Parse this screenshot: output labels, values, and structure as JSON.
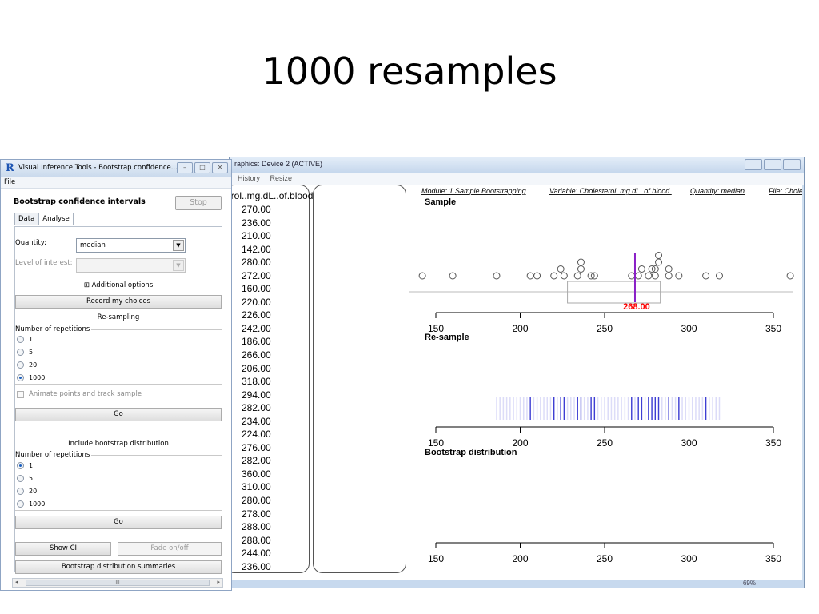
{
  "slide": {
    "title": "1000 resamples"
  },
  "graphics_window": {
    "title": "raphics: Device 2 (ACTIVE)",
    "menu": [
      "History",
      "Resize"
    ],
    "status": "69%",
    "data_column": {
      "header": "erol..mg.dL..of.blood.",
      "values": [
        "270.00",
        "236.00",
        "210.00",
        "142.00",
        "280.00",
        "272.00",
        "160.00",
        "220.00",
        "226.00",
        "242.00",
        "186.00",
        "266.00",
        "206.00",
        "318.00",
        "294.00",
        "282.00",
        "234.00",
        "224.00",
        "276.00",
        "282.00",
        "360.00",
        "310.00",
        "280.00",
        "278.00",
        "288.00",
        "288.00",
        "244.00",
        "236.00"
      ]
    },
    "plot": {
      "header": {
        "module": "Module: 1 Sample Bootstrapping",
        "variable": "Variable: Cholesterol..mg.dL..of.blood.",
        "quantity": "Quantity: median",
        "file": "File: Chole"
      },
      "panels": {
        "sample": "Sample",
        "resample": "Re-sample",
        "bootstrap": "Bootstrap distribution"
      },
      "median_label": "268.00",
      "median_value": 268,
      "axis_ticks": [
        "150",
        "200",
        "250",
        "300",
        "350"
      ],
      "colors": {
        "median_line": "#8a1fc7",
        "median_text": "#ff0000",
        "resample_lines": "#2222cc"
      }
    }
  },
  "chart_data": {
    "type": "scatter",
    "title": "Sample",
    "xlim": [
      150,
      350
    ],
    "sample_points": [
      142,
      160,
      186,
      206,
      210,
      220,
      224,
      226,
      234,
      236,
      236,
      242,
      244,
      266,
      270,
      272,
      276,
      278,
      280,
      280,
      282,
      282,
      288,
      288,
      294,
      310,
      318,
      360
    ],
    "boxplot": {
      "q1": 228,
      "median": 268,
      "q3": 283
    },
    "median": 268,
    "resample_values": [
      206,
      220,
      224,
      226,
      234,
      236,
      242,
      244,
      266,
      270,
      272,
      276,
      278,
      280,
      282,
      288,
      294,
      310
    ]
  },
  "control_panel": {
    "title": "Visual Inference Tools - Bootstrap confidence...",
    "menu": [
      "File"
    ],
    "heading": "Bootstrap confidence intervals",
    "stop_label": "Stop",
    "tabs": [
      "Data",
      "Analyse"
    ],
    "quantity_label": "Quantity:",
    "quantity_value": "median",
    "level_label": "Level of interest:",
    "additional_options": "Additional options",
    "record_button": "Record my choices",
    "resampling_label": "Re-sampling",
    "reps_label_1": "Number of repetitions",
    "reps_options_1": [
      "1",
      "5",
      "20",
      "1000"
    ],
    "reps_selected_1": "1000",
    "animate_label": "Animate points and track sample",
    "go_label": "Go",
    "include_label": "Include bootstrap distribution",
    "reps_label_2": "Number of repetitions",
    "reps_options_2": [
      "1",
      "5",
      "20",
      "1000"
    ],
    "reps_selected_2": "1",
    "show_ci_label": "Show CI",
    "fade_label": "Fade on/off",
    "summaries_label": "Bootstrap distribution summaries",
    "scroll_thumb": "III"
  }
}
